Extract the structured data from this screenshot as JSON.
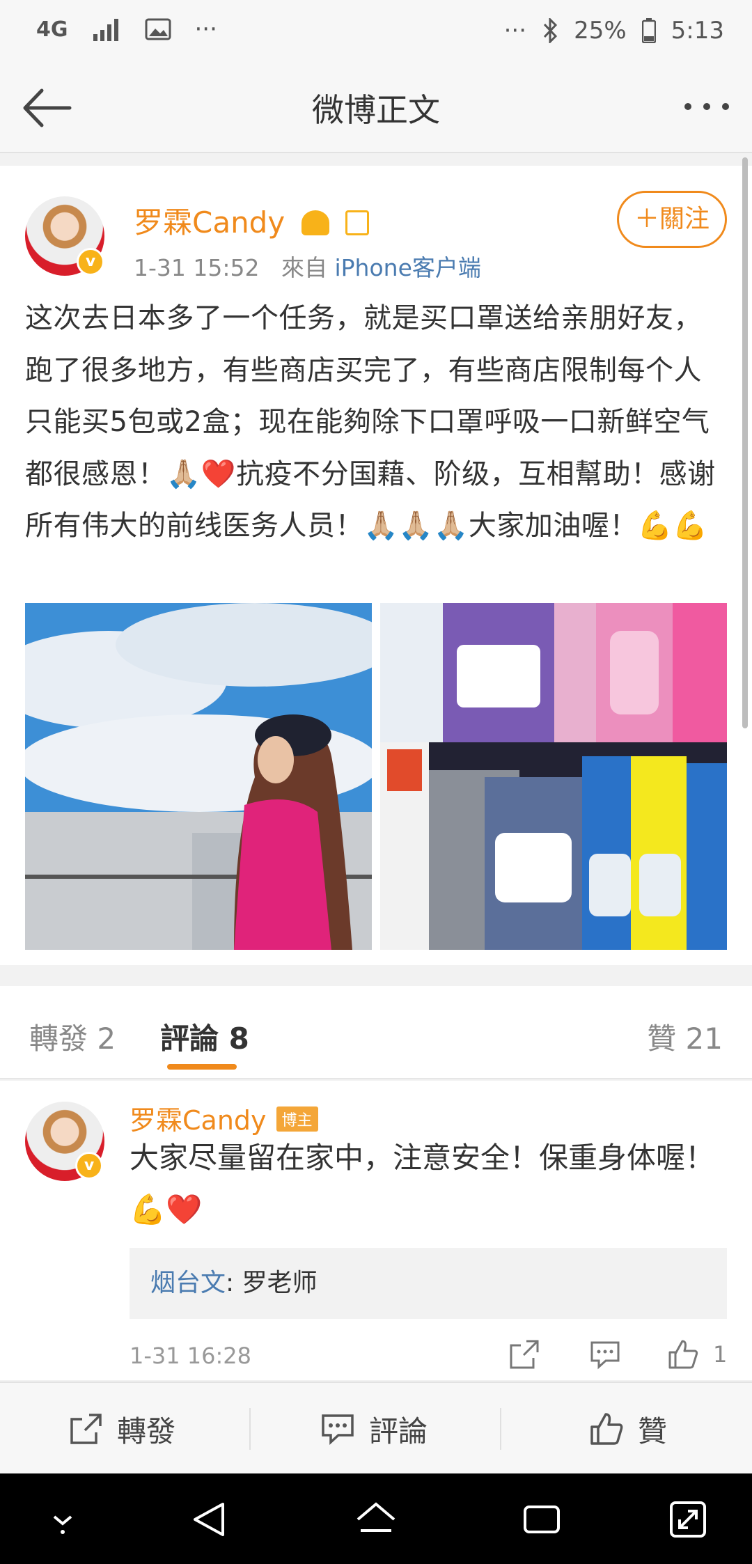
{
  "status_bar": {
    "network": "4G",
    "dots_left": "···",
    "dots_right": "···",
    "battery": "25%",
    "time": "5:13"
  },
  "nav": {
    "title": "微博正文"
  },
  "post": {
    "author": "罗霖Candy",
    "verified_badge": "v",
    "time": "1-31 15:52",
    "source_prefix": "來自",
    "source": "iPhone客户端",
    "follow_label": "＋關注",
    "text": "这次去日本多了一个任务，就是买口罩送给亲朋好友，跑了很多地方，有些商店买完了，有些商店限制每个人只能买5包或2盒；现在能夠除下口罩呼吸一口新鲜空气都很感恩！🙏🏼❤️抗疫不分国藉、阶级，互相幫助！感谢所有伟大的前线医务人员！🙏🏼🙏🏼🙏🏼大家加油喔！💪💪",
    "images": [
      "photo-woman-sky",
      "photo-masks"
    ]
  },
  "tabs": {
    "repost": "轉發 2",
    "comments": "評論 8",
    "likes": "贊 21"
  },
  "comment": {
    "author": "罗霖Candy",
    "tag": "博主",
    "text": "大家尽量留在家中，注意安全！保重身体喔！💪❤️",
    "reply_name": "烟台文",
    "reply_text": ": 罗老师",
    "time": "1-31 16:28",
    "like_count": "1"
  },
  "action_bar": {
    "repost": "轉發",
    "comment": "評論",
    "like": "贊"
  },
  "colors": {
    "accent": "#f08a1c",
    "link": "#4a7bb0"
  }
}
